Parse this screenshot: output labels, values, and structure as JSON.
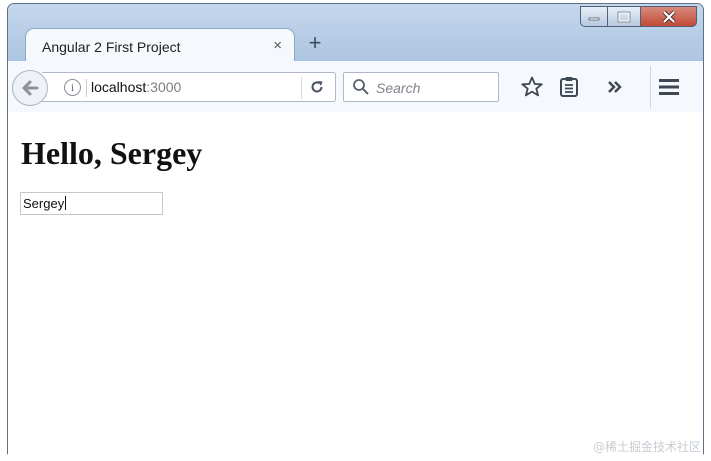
{
  "window": {
    "controls": [
      "minimize",
      "maximize",
      "close"
    ]
  },
  "tabs": [
    {
      "title": "Angular 2 First Project",
      "close_label": "×",
      "active": true
    }
  ],
  "new_tab_label": "+",
  "nav": {
    "url_host": "localhost",
    "url_port": ":3000",
    "search_placeholder": "Search"
  },
  "page": {
    "heading": "Hello, Sergey",
    "input_value": "Sergey"
  },
  "watermark": "@稀土掘金技术社区",
  "icons": {
    "back": "back-arrow-icon",
    "info": "info-icon",
    "reload": "reload-icon",
    "search": "search-icon",
    "bookmark": "star-icon",
    "reading_list": "clipboard-icon",
    "overflow": "double-chevron-icon",
    "menu": "hamburger-menu-icon"
  },
  "colors": {
    "frame": "#a8c2df",
    "close_button": "#c24a36",
    "toolbar": "#f5f8fc"
  }
}
